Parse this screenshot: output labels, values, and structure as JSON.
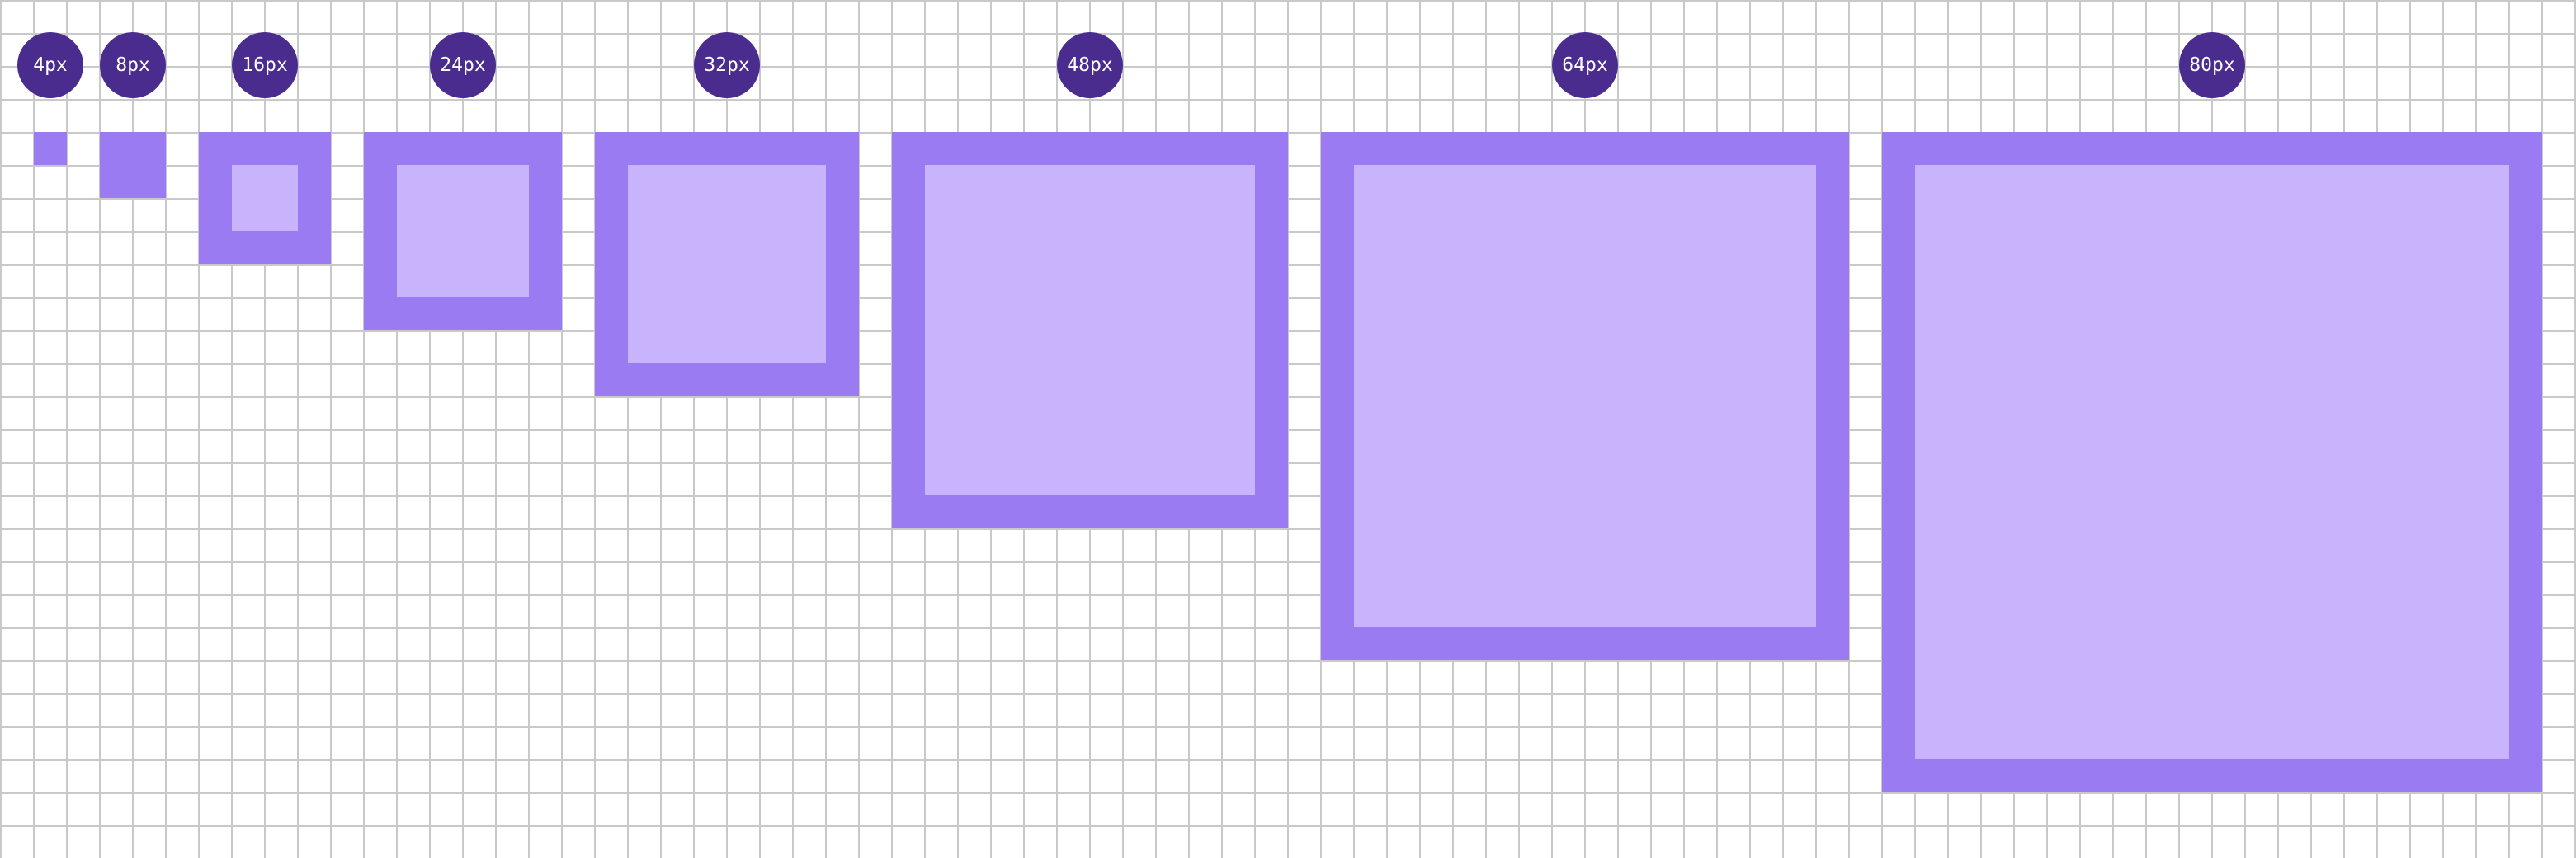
{
  "colors": {
    "badge_background": "#4a2c8f",
    "badge_text": "#ffffff",
    "swatch_border": "#9b7bf1",
    "swatch_fill": "#d4c4ff",
    "grid_line": "#c9c9c9",
    "background": "#ffffff"
  },
  "sizes": [
    {
      "label": "4px"
    },
    {
      "label": "8px"
    },
    {
      "label": "16px"
    },
    {
      "label": "24px"
    },
    {
      "label": "32px"
    },
    {
      "label": "48px"
    },
    {
      "label": "64px"
    },
    {
      "label": "80px"
    }
  ]
}
